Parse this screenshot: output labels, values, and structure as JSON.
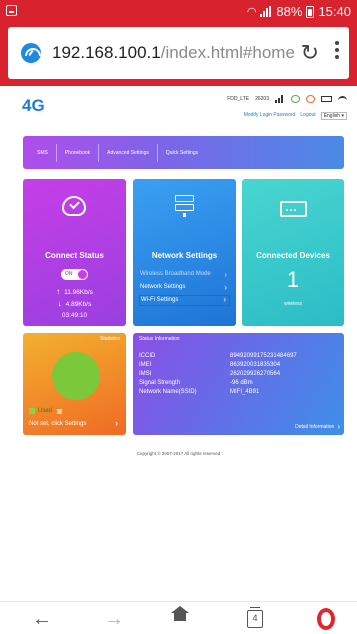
{
  "status_bar": {
    "battery_percent": "88%",
    "time": "15:40"
  },
  "browser": {
    "url_host": "192.168.100.1",
    "url_path": "/index.html#home",
    "tab_count": "4"
  },
  "router_header": {
    "brand": "4G",
    "network_type": "FDD_LTE",
    "operator_code": "26203",
    "links": [
      "Modify Login Password",
      "Logout"
    ],
    "language": "English ▾"
  },
  "nav": {
    "items": [
      "SMS",
      "Phonebook",
      "Advanced Settings",
      "Quick Settings"
    ]
  },
  "connect_card": {
    "title": "Connect Status",
    "toggle": "ON",
    "upload": "11.96Kb/s",
    "download": "4.89Kb/s",
    "duration": "03:49:10"
  },
  "network_card": {
    "title": "Network Settings",
    "items": [
      "Wireless Broadband Mode",
      "Network Settings",
      "Wi-Fi Settings"
    ]
  },
  "devices_card": {
    "title": "Connected Devices",
    "count": "1",
    "label": "wireless"
  },
  "stats_card": {
    "label": "Statistics",
    "legend_used": "Used",
    "footer": "Not set, click Settings"
  },
  "info_card": {
    "title": "Status Information",
    "rows": [
      {
        "key": "ICCID",
        "value": "89492099175231484697"
      },
      {
        "key": "IMEI",
        "value": "863920031835304"
      },
      {
        "key": "IMSI",
        "value": "262029926270564"
      },
      {
        "key": "Signal Strength",
        "value": "-96 dBm"
      },
      {
        "key": "Network Name(SSID)",
        "value": "MIFI_4B91"
      }
    ],
    "detail_link": "Detail Information"
  },
  "footer": {
    "copyright": "Copyright © 2007-2017 All rights reserved"
  },
  "colors": {
    "browser_red": "#d8232f",
    "brand_blue": "#1e7bd8",
    "highlight_red": "#e0262f",
    "pie_green": "#7bc83a"
  }
}
